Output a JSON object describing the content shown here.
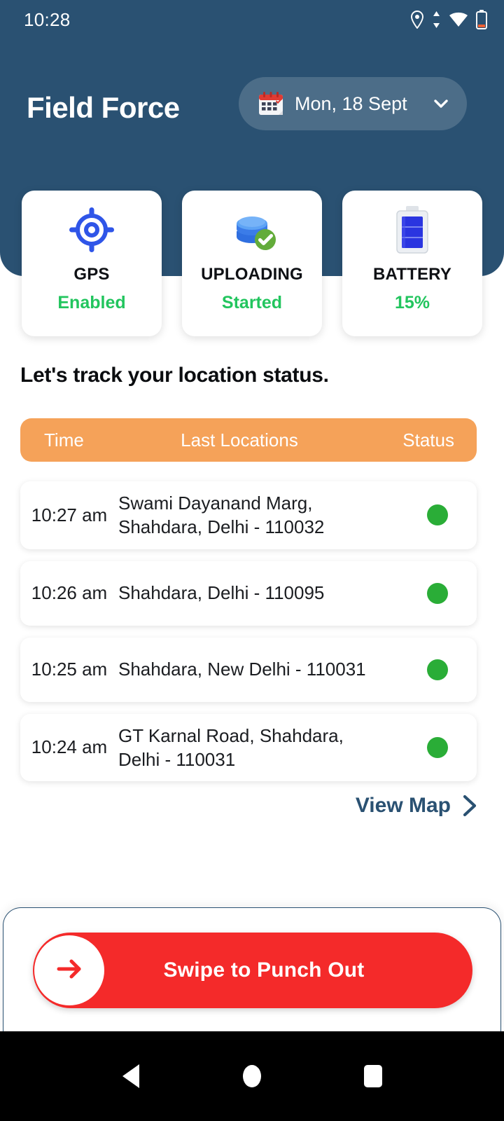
{
  "statusbar": {
    "clock": "10:28",
    "icons": [
      "location-pin-icon",
      "data-transfer-icon",
      "wifi-icon",
      "battery-low-icon"
    ]
  },
  "header": {
    "app_title": "Field Force",
    "background_color": "#2a5172",
    "date_chip": {
      "icon": "calendar-icon",
      "label": "Mon, 18 Sept",
      "chevron": "chevron-down-icon"
    }
  },
  "status_cards": [
    {
      "icon": "gps-target-icon",
      "title": "GPS",
      "value": "Enabled",
      "value_color": "#22c55e"
    },
    {
      "icon": "database-check-icon",
      "title": "UPLOADING",
      "value": "Started",
      "value_color": "#22c55e"
    },
    {
      "icon": "battery-icon",
      "title": "BATTERY",
      "value": "15%",
      "value_color": "#22c55e"
    }
  ],
  "main": {
    "section_heading": "Let's track your location status.",
    "table": {
      "header_color": "#f5a259",
      "columns": [
        "Time",
        "Last Locations",
        "Status"
      ],
      "rows": [
        {
          "time": "10:27 am",
          "location": "Swami Dayanand Marg, Shahdara, Delhi - 110032",
          "status_color": "#2aad37"
        },
        {
          "time": "10:26 am",
          "location": "Shahdara, Delhi - 110095",
          "status_color": "#2aad37"
        },
        {
          "time": "10:25 am",
          "location": "Shahdara, New Delhi - 110031",
          "status_color": "#2aad37"
        },
        {
          "time": "10:24 am",
          "location": "GT Karnal Road, Shahdara, Delhi - 110031",
          "status_color": "#2aad37"
        }
      ]
    },
    "view_map": {
      "label": "View Map",
      "chevron": "chevron-right-icon"
    }
  },
  "swipe": {
    "label": "Swipe to Punch Out",
    "track_color": "#f42a2a",
    "knob_icon": "arrow-right-icon"
  },
  "navbar": {
    "buttons": [
      "back-icon",
      "home-icon",
      "recents-icon"
    ]
  }
}
